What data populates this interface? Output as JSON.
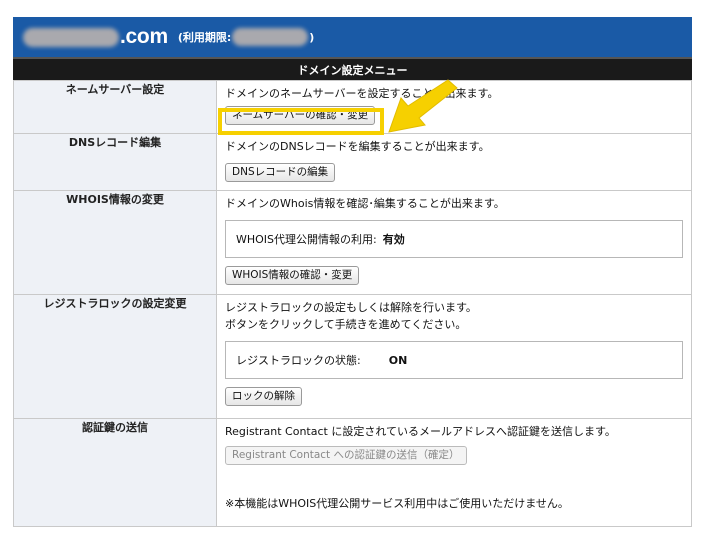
{
  "header": {
    "domain_tld": ".com",
    "expiry_prefix": "(利用期限:",
    "expiry_suffix": ")",
    "bg_color": "#1a5aa6"
  },
  "menu_title": "ドメイン設定メニュー",
  "rows": {
    "nameserver": {
      "label": "ネームサーバー設定",
      "desc": "ドメインのネームサーバーを設定することが出来ます。",
      "button": "ネームサーバーの確認・変更"
    },
    "dns": {
      "label": "DNSレコード編集",
      "desc": "ドメインのDNSレコードを編集することが出来ます。",
      "button": "DNSレコードの編集"
    },
    "whois": {
      "label": "WHOIS情報の変更",
      "desc": "ドメインのWhois情報を確認･編集することが出来ます。",
      "status_label": "WHOIS代理公開情報の利用:",
      "status_value": "有効",
      "button": "WHOIS情報の確認・変更"
    },
    "registrylock": {
      "label": "レジストラロックの設定変更",
      "desc1": "レジストラロックの設定もしくは解除を行います。",
      "desc2": "ボタンをクリックして手続きを進めてください。",
      "status_label": "レジストラロックの状態:",
      "status_value": "ON",
      "button": "ロックの解除"
    },
    "authkey": {
      "label": "認証鍵の送信",
      "desc": "Registrant Contact に設定されているメールアドレスへ認証鍵を送信します。",
      "button": "Registrant Contact への認証鍵の送信（確定）",
      "note": "※本機能はWHOIS代理公開サービス利用中はご使用いただけません。"
    }
  },
  "highlight_color": "#f6d000",
  "icons": {
    "annotation": "arrow-icon"
  }
}
